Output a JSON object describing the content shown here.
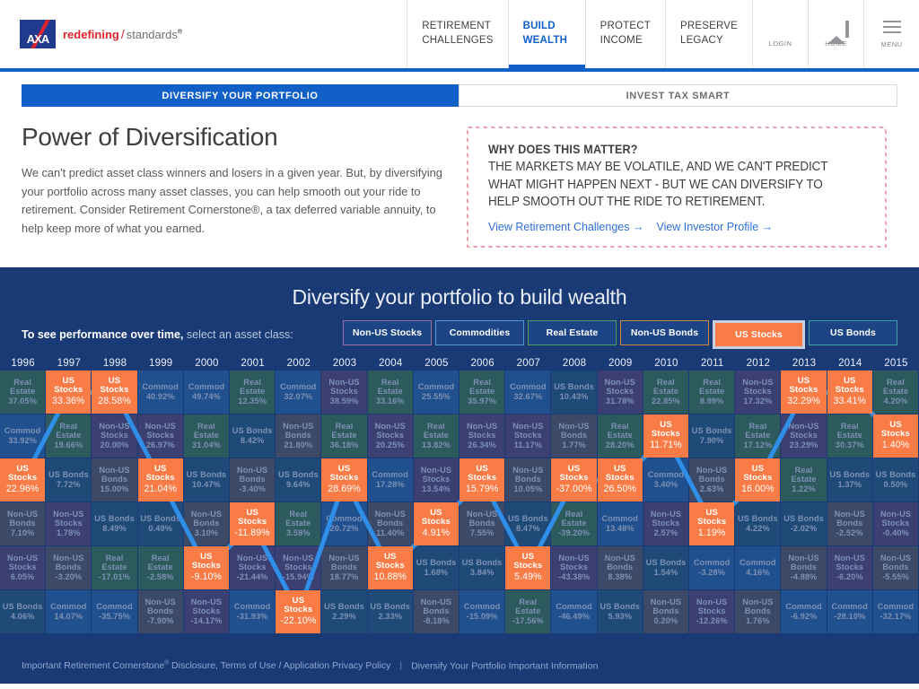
{
  "header": {
    "logo_letters": "AXA",
    "tagline_red": "redefining",
    "tagline_slash": "/",
    "tagline_gray": "standards",
    "nav": [
      {
        "line1": "RETIREMENT",
        "line2": "CHALLENGES",
        "active": false
      },
      {
        "line1": "BUILD",
        "line2": "WEALTH",
        "active": true
      },
      {
        "line1": "PROTECT",
        "line2": "INCOME",
        "active": false
      },
      {
        "line1": "PRESERVE",
        "line2": "LEGACY",
        "active": false
      }
    ],
    "login_label": "LOGIN",
    "home_label": "HOME",
    "menu_label": "MENU"
  },
  "subtabs": [
    {
      "label": "DIVERSIFY YOUR PORTFOLIO",
      "active": true
    },
    {
      "label": "INVEST TAX SMART",
      "active": false
    }
  ],
  "intro": {
    "title": "Power of Diversification",
    "body": "We can't predict asset class winners and losers in a given year. But, by diversifying your portfolio across many asset classes, you can help smooth out your ride to retirement. Consider Retirement Cornerstone®, a tax deferred variable annuity, to help keep more of what you earned."
  },
  "matter": {
    "heading": "WHY DOES THIS MATTER?",
    "paragraph": "THE MARKETS MAY BE VOLATILE, AND WE CAN'T PREDICT WHAT MIGHT HAPPEN NEXT - BUT WE CAN DIVERSIFY TO HELP SMOOTH OUT THE RIDE TO RETIREMENT.",
    "link1": "View Retirement Challenges →",
    "link2": "View Investor Profile →"
  },
  "panel": {
    "title": "Diversify your portfolio to build wealth",
    "selector_bold": "To see performance over time,",
    "selector_light": " select an asset class:",
    "asset_buttons": [
      {
        "label": "Non-US Stocks",
        "selected": false,
        "border": "#9b6fa8"
      },
      {
        "label": "Commodities",
        "selected": false,
        "border": "#4d9ad6"
      },
      {
        "label": "Real Estate",
        "selected": false,
        "border": "#4e9e5c"
      },
      {
        "label": "Non-US Bonds",
        "selected": false,
        "border": "#c98a44"
      },
      {
        "label": "US Stocks",
        "selected": true,
        "border": "#c6d0e0"
      },
      {
        "label": "US Bonds",
        "selected": false,
        "border": "#3f9fa8"
      }
    ]
  },
  "footer": {
    "link1_a": "Important Retirement Cornerstone",
    "link1_sup": "®",
    "link1_b": " Disclosure, Terms of Use / Application Privacy Policy",
    "sep": "|",
    "link2": "Diversify Your Portfolio Important Information"
  },
  "chart_data": {
    "type": "heatmap",
    "title": "Diversify your portfolio to build wealth",
    "highlight_asset": "US Stocks",
    "highlight_color": "#f97b45",
    "asset_colors": {
      "Real Estate": "#2d5a5c",
      "Commod": "#21508f",
      "US Stocks": "#f97b45",
      "US Bonds": "#1f4a78",
      "Non-US Stocks": "#3b3f72",
      "Non-US Bonds": "#3c4a68"
    },
    "categories": [
      "1996",
      "1997",
      "1998",
      "1999",
      "2000",
      "2001",
      "2002",
      "2003",
      "2004",
      "2005",
      "2006",
      "2007",
      "2008",
      "2009",
      "2010",
      "2011",
      "2012",
      "2013",
      "2014",
      "2015"
    ],
    "rank_rows": 6,
    "columns": [
      {
        "year": "1996",
        "cells": [
          {
            "name": "Real Estate",
            "value": "37.05%"
          },
          {
            "name": "Commod",
            "value": "33.92%"
          },
          {
            "name": "US Stocks",
            "value": "22.96%"
          },
          {
            "name": "Non-US Bonds",
            "value": "7.10%"
          },
          {
            "name": "Non-US Stocks",
            "value": "6.05%"
          },
          {
            "name": "US Bonds",
            "value": "4.06%"
          }
        ]
      },
      {
        "year": "1997",
        "cells": [
          {
            "name": "US Stocks",
            "value": "33.36%"
          },
          {
            "name": "Real Estate",
            "value": "19.66%"
          },
          {
            "name": "US Bonds",
            "value": "7.72%"
          },
          {
            "name": "Non-US Stocks",
            "value": "1.78%"
          },
          {
            "name": "Non-US Bonds",
            "value": "-3.20%"
          },
          {
            "name": "Commod",
            "value": "14.07%"
          }
        ]
      },
      {
        "year": "1998",
        "cells": [
          {
            "name": "US Stocks",
            "value": "28.58%"
          },
          {
            "name": "Non-US Stocks",
            "value": "20.00%"
          },
          {
            "name": "Non-US Bonds",
            "value": "15.00%"
          },
          {
            "name": "US Bonds",
            "value": "8.49%"
          },
          {
            "name": "Real Estate",
            "value": "-17.01%"
          },
          {
            "name": "Commod",
            "value": "-35.75%"
          }
        ]
      },
      {
        "year": "1999",
        "cells": [
          {
            "name": "Commod",
            "value": "40.92%"
          },
          {
            "name": "Non-US Stocks",
            "value": "26.97%"
          },
          {
            "name": "US Stocks",
            "value": "21.04%"
          },
          {
            "name": "US Bonds",
            "value": "0.49%"
          },
          {
            "name": "Real Estate",
            "value": "-2.58%"
          },
          {
            "name": "Non-US Bonds",
            "value": "-7.90%"
          }
        ]
      },
      {
        "year": "2000",
        "cells": [
          {
            "name": "Commod",
            "value": "49.74%"
          },
          {
            "name": "Real Estate",
            "value": "31.04%"
          },
          {
            "name": "US Bonds",
            "value": "10.47%"
          },
          {
            "name": "Non-US Bonds",
            "value": "3.10%"
          },
          {
            "name": "US Stocks",
            "value": "-9.10%"
          },
          {
            "name": "Non-US Stocks",
            "value": "-14.17%"
          }
        ]
      },
      {
        "year": "2001",
        "cells": [
          {
            "name": "Real Estate",
            "value": "12.35%"
          },
          {
            "name": "US Bonds",
            "value": "8.42%"
          },
          {
            "name": "Non-US Bonds",
            "value": "-3.40%"
          },
          {
            "name": "US Stocks",
            "value": "-11.89%"
          },
          {
            "name": "Non-US Stocks",
            "value": "-21.44%"
          },
          {
            "name": "Commod",
            "value": "-31.93%"
          }
        ]
      },
      {
        "year": "2002",
        "cells": [
          {
            "name": "Commod",
            "value": "32.07%"
          },
          {
            "name": "Non-US Bonds",
            "value": "21.80%"
          },
          {
            "name": "US Bonds",
            "value": "9.64%"
          },
          {
            "name": "Real Estate",
            "value": "3.58%"
          },
          {
            "name": "Non-US Stocks",
            "value": "-15.94%"
          },
          {
            "name": "US Stocks",
            "value": "-22.10%"
          }
        ]
      },
      {
        "year": "2003",
        "cells": [
          {
            "name": "Non-US Stocks",
            "value": "38.59%"
          },
          {
            "name": "Real Estate",
            "value": "36.18%"
          },
          {
            "name": "US Stocks",
            "value": "28.69%"
          },
          {
            "name": "Commod",
            "value": "20.72%"
          },
          {
            "name": "Non-US Bonds",
            "value": "18.77%"
          },
          {
            "name": "US Bonds",
            "value": "2.29%"
          }
        ]
      },
      {
        "year": "2004",
        "cells": [
          {
            "name": "Real Estate",
            "value": "33.16%"
          },
          {
            "name": "Non-US Stocks",
            "value": "20.25%"
          },
          {
            "name": "Commod",
            "value": "17.28%"
          },
          {
            "name": "Non-US Bonds",
            "value": "11.40%"
          },
          {
            "name": "US Stocks",
            "value": "10.88%"
          },
          {
            "name": "US Bonds",
            "value": "2.33%"
          }
        ]
      },
      {
        "year": "2005",
        "cells": [
          {
            "name": "Commod",
            "value": "25.55%"
          },
          {
            "name": "Real Estate",
            "value": "13.82%"
          },
          {
            "name": "Non-US Stocks",
            "value": "13.54%"
          },
          {
            "name": "US Stocks",
            "value": "4.91%"
          },
          {
            "name": "US Bonds",
            "value": "1.68%"
          },
          {
            "name": "Non-US Bonds",
            "value": "-8.18%"
          }
        ]
      },
      {
        "year": "2006",
        "cells": [
          {
            "name": "Real Estate",
            "value": "35.97%"
          },
          {
            "name": "Non-US Stocks",
            "value": "26.34%"
          },
          {
            "name": "US Stocks",
            "value": "15.79%"
          },
          {
            "name": "Non-US Bonds",
            "value": "7.55%"
          },
          {
            "name": "US Bonds",
            "value": "3.84%"
          },
          {
            "name": "Commod",
            "value": "-15.09%"
          }
        ]
      },
      {
        "year": "2007",
        "cells": [
          {
            "name": "Commod",
            "value": "32.67%"
          },
          {
            "name": "Non-US Stocks",
            "value": "11.17%"
          },
          {
            "name": "Non-US Bonds",
            "value": "10.05%"
          },
          {
            "name": "US Bonds",
            "value": "8.47%"
          },
          {
            "name": "US Stocks",
            "value": "5.49%"
          },
          {
            "name": "Real Estate",
            "value": "-17.56%"
          }
        ]
      },
      {
        "year": "2008",
        "cells": [
          {
            "name": "US Bonds",
            "value": "10.43%"
          },
          {
            "name": "Non-US Bonds",
            "value": "1.77%"
          },
          {
            "name": "US Stocks",
            "value": "-37.00%"
          },
          {
            "name": "Real Estate",
            "value": "-39.20%"
          },
          {
            "name": "Non-US Stocks",
            "value": "-43.38%"
          },
          {
            "name": "Commod",
            "value": "-46.49%"
          }
        ]
      },
      {
        "year": "2009",
        "cells": [
          {
            "name": "Non-US Stocks",
            "value": "31.78%"
          },
          {
            "name": "Real Estate",
            "value": "28.20%"
          },
          {
            "name": "US Stocks",
            "value": "26.50%"
          },
          {
            "name": "Commod",
            "value": "13.48%"
          },
          {
            "name": "Non-US Bonds",
            "value": "8.38%"
          },
          {
            "name": "US Bonds",
            "value": "5.93%"
          }
        ]
      },
      {
        "year": "2010",
        "cells": [
          {
            "name": "Real Estate",
            "value": "22.85%"
          },
          {
            "name": "US Stocks",
            "value": "11.71%"
          },
          {
            "name": "Commod",
            "value": "3.40%"
          },
          {
            "name": "Non-US Stocks",
            "value": "2.57%"
          },
          {
            "name": "US Bonds",
            "value": "1.54%"
          },
          {
            "name": "Non-US Bonds",
            "value": "0.20%"
          }
        ]
      },
      {
        "year": "2011",
        "cells": [
          {
            "name": "Real Estate",
            "value": "8.99%"
          },
          {
            "name": "US Bonds",
            "value": "7.90%"
          },
          {
            "name": "Non-US Bonds",
            "value": "2.63%"
          },
          {
            "name": "US Stocks",
            "value": "1.19%"
          },
          {
            "name": "Commod",
            "value": "-3.28%"
          },
          {
            "name": "Non-US Stocks",
            "value": "-12.26%"
          }
        ]
      },
      {
        "year": "2012",
        "cells": [
          {
            "name": "Non-US Stocks",
            "value": "17.32%"
          },
          {
            "name": "Real Estate",
            "value": "17.12%"
          },
          {
            "name": "US Stocks",
            "value": "16.00%"
          },
          {
            "name": "US Bonds",
            "value": "4.22%"
          },
          {
            "name": "Commod",
            "value": "4.16%"
          },
          {
            "name": "Non-US Bonds",
            "value": "1.76%"
          }
        ]
      },
      {
        "year": "2013",
        "cells": [
          {
            "name": "US Stocks",
            "value": "32.29%"
          },
          {
            "name": "Non-US Stocks",
            "value": "23.29%"
          },
          {
            "name": "Real Estate",
            "value": "1.22%"
          },
          {
            "name": "US Bonds",
            "value": "-2.02%"
          },
          {
            "name": "Non-US Bonds",
            "value": "-4.88%"
          },
          {
            "name": "Commod",
            "value": "-6.92%"
          }
        ]
      },
      {
        "year": "2014",
        "cells": [
          {
            "name": "US Stocks",
            "value": "33.41%"
          },
          {
            "name": "Real Estate",
            "value": "30.37%"
          },
          {
            "name": "US Bonds",
            "value": "1.37%"
          },
          {
            "name": "Non-US Bonds",
            "value": "-2.52%"
          },
          {
            "name": "Non-US Stocks",
            "value": "-6.20%"
          },
          {
            "name": "Commod",
            "value": "-28.10%"
          }
        ]
      },
      {
        "year": "2015",
        "cells": [
          {
            "name": "Real Estate",
            "value": "4.20%"
          },
          {
            "name": "US Stocks",
            "value": "1.40%"
          },
          {
            "name": "US Bonds",
            "value": "0.50%"
          },
          {
            "name": "Non-US Stocks",
            "value": "-0.40%"
          },
          {
            "name": "Non-US Bonds",
            "value": "-5.55%"
          },
          {
            "name": "Commod",
            "value": "-32.17%"
          }
        ]
      }
    ]
  }
}
